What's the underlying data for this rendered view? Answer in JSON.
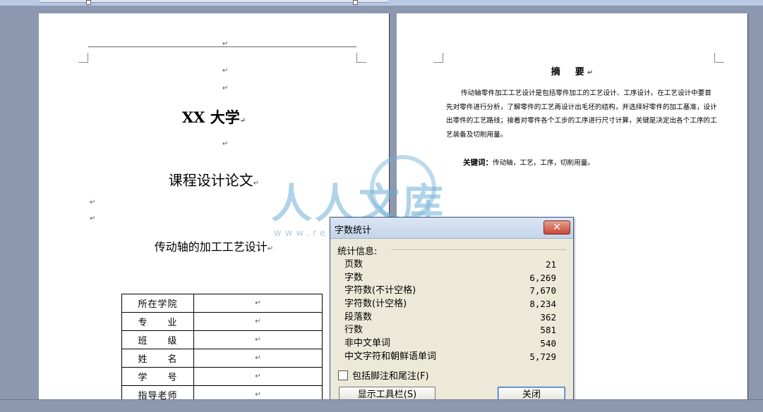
{
  "document": {
    "left_page": {
      "university": "XX 大学",
      "course_title": "课程设计论文",
      "subject_title": "传动轴的加工工艺设计",
      "info_table": [
        {
          "label": "所在学院",
          "value": ""
        },
        {
          "label": "专　　业",
          "value": ""
        },
        {
          "label": "班　　级",
          "value": ""
        },
        {
          "label": "姓　　名",
          "value": ""
        },
        {
          "label": "学　　号",
          "value": ""
        },
        {
          "label": "指导老师",
          "value": ""
        }
      ]
    },
    "right_page": {
      "abstract_title": "摘　要",
      "abstract_body": "传动轴零件加工工艺设计是包括零件加工的工艺设计、工序设计。在工艺设计中要首先对零件进行分析，了解零件的工艺再设计出毛坯的结构，并选择好零件的加工基准，设计出零件的工艺路线；接着对零件各个工步的工序进行尺寸计算，关键是决定出各个工序的工艺装备及切削用量。",
      "keywords_label": "关键词：",
      "keywords": "传动轴，工艺，工序，切削用量。"
    },
    "paragraph_mark": "↵"
  },
  "watermark": {
    "text": "人人文库",
    "url": "www.renrendoc.com"
  },
  "dialog": {
    "title": "字数统计",
    "close_glyph": "✕",
    "section_label": "统计信息:",
    "stats": [
      {
        "label": "页数",
        "value": "21"
      },
      {
        "label": "字数",
        "value": "6,269"
      },
      {
        "label": "字符数(不计空格)",
        "value": "7,670"
      },
      {
        "label": "字符数(计空格)",
        "value": "8,234"
      },
      {
        "label": "段落数",
        "value": "362"
      },
      {
        "label": "行数",
        "value": "581"
      },
      {
        "label": "非中文单词",
        "value": "540"
      },
      {
        "label": "中文字符和朝鲜语单词",
        "value": "5,729"
      }
    ],
    "checkbox_label": "包括脚注和尾注(F)",
    "checkbox_checked": false,
    "show_toolbar_button": "显示工具栏(S)",
    "close_button": "关闭"
  }
}
